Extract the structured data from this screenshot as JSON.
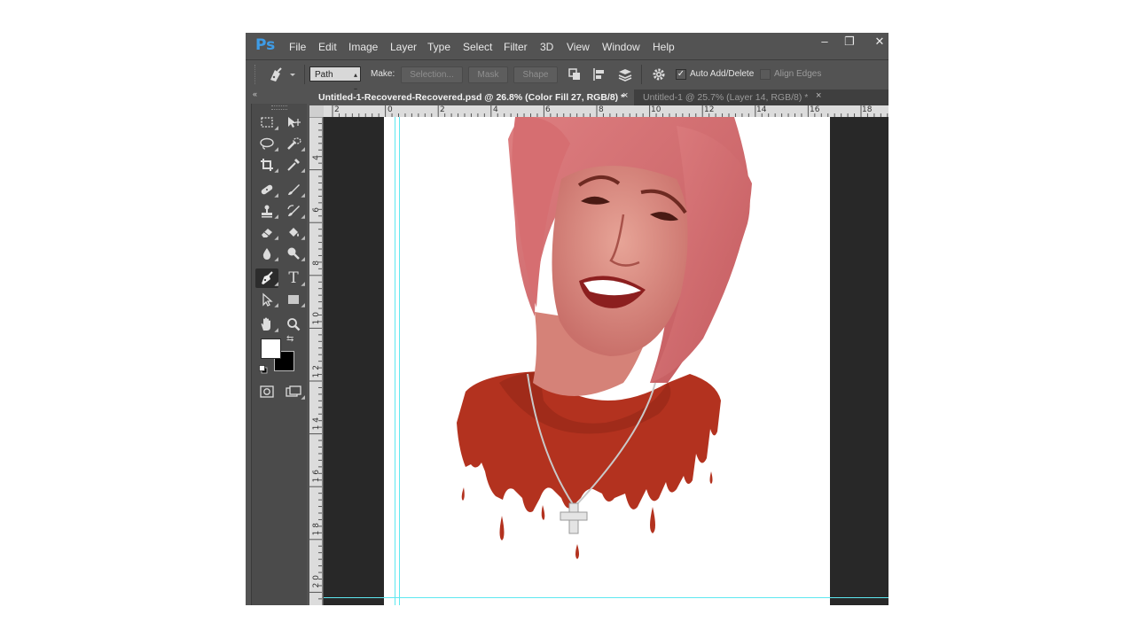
{
  "app": {
    "logo": "Ps"
  },
  "menu": [
    "File",
    "Edit",
    "Image",
    "Layer",
    "Type",
    "Select",
    "Filter",
    "3D",
    "View",
    "Window",
    "Help"
  ],
  "window_controls": {
    "minimize": "–",
    "restore": "❐",
    "close": "✕"
  },
  "options_bar": {
    "mode_value": "Path",
    "make_label": "Make:",
    "selection_label": "Selection...",
    "mask_label": "Mask",
    "shape_label": "Shape",
    "auto_add_delete_label": "Auto Add/Delete",
    "auto_add_delete_checked": true,
    "align_edges_label": "Align Edges",
    "align_edges_checked": false
  },
  "tabs": [
    {
      "label": "Untitled-1-Recovered-Recovered.psd @ 26.8% (Color Fill 27, RGB/8) *",
      "active": true
    },
    {
      "label": "Untitled-1 @ 25.7% (Layer 14, RGB/8) *",
      "active": false
    }
  ],
  "tab_close": "×",
  "ruler_h_labels": [
    "2",
    "0",
    "2",
    "4",
    "6",
    "8",
    "10",
    "12",
    "14",
    "16",
    "18"
  ],
  "ruler_v_labels": [
    "4",
    "6",
    "8",
    "1 0",
    "1 2",
    "1 4",
    "1 6",
    "1 8",
    "2 0"
  ],
  "colors": {
    "foreground": "#ffffff",
    "background": "#000000",
    "accent": "#3e9ce7",
    "guide": "#5ee8f0",
    "shirt": "#b3321f",
    "hair": "#cf6a6d",
    "skin": "#d98a80"
  },
  "icons": {
    "pen_tool": "pen-tool-icon",
    "marquee": "rectangular-marquee-icon",
    "move": "move-icon",
    "lasso": "lasso-icon",
    "quick_select": "quick-selection-icon",
    "crop": "crop-icon",
    "eyedropper": "eyedropper-icon",
    "healing": "healing-brush-icon",
    "brush": "brush-icon",
    "stamp": "clone-stamp-icon",
    "history_brush": "history-brush-icon",
    "eraser": "eraser-icon",
    "bucket": "paint-bucket-icon",
    "blur": "blur-icon",
    "dodge": "dodge-icon",
    "type": "type-tool-icon",
    "path_select": "path-selection-icon",
    "rectangle": "rectangle-tool-icon",
    "hand": "hand-icon",
    "zoom": "zoom-icon",
    "quick_mask": "quick-mask-icon",
    "screen_mode": "screen-mode-icon",
    "gear": "gear-icon"
  }
}
